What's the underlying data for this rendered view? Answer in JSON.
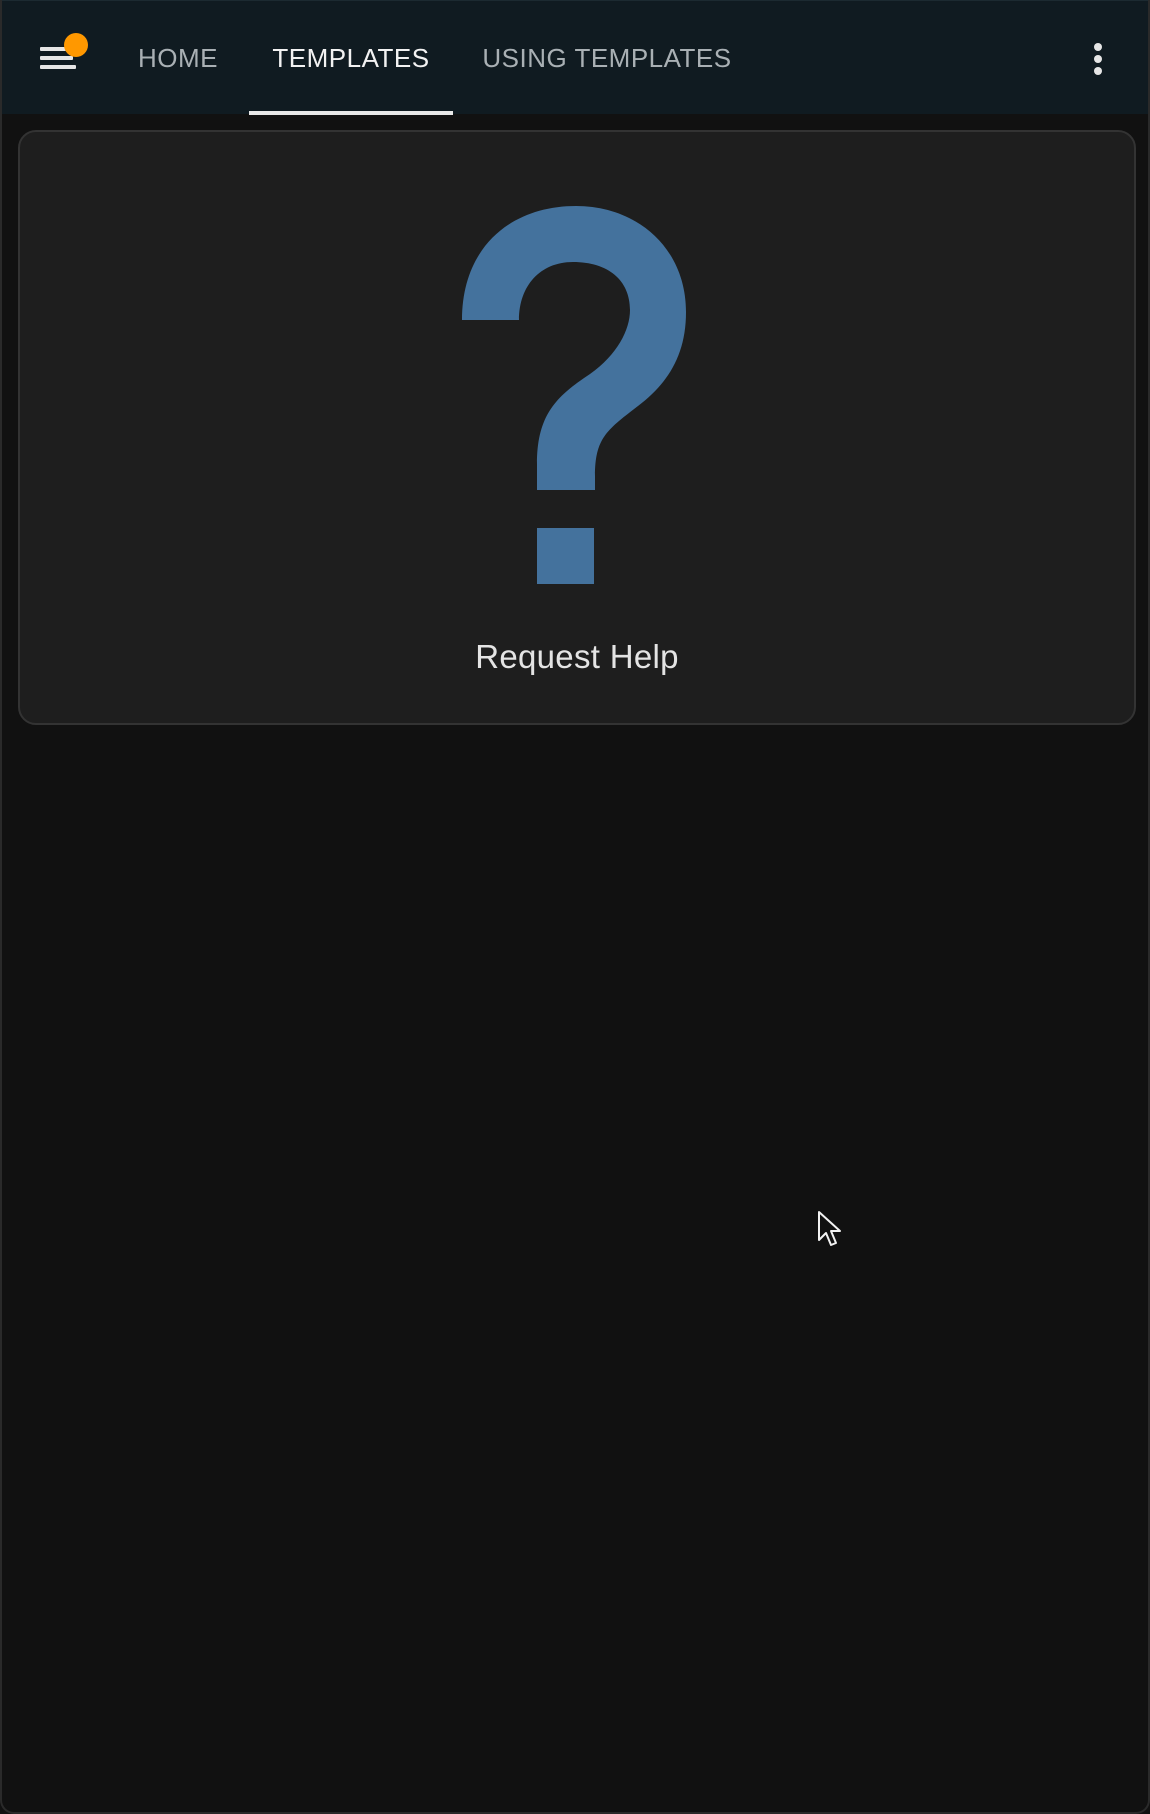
{
  "header": {
    "tabs": [
      {
        "label": "HOME",
        "active": false
      },
      {
        "label": "TEMPLATES",
        "active": true
      },
      {
        "label": "USING TEMPLATES",
        "active": false
      }
    ],
    "menu_icon": "menu-icon",
    "notification_dot_color": "#ff9800",
    "overflow_icon": "more-vertical-icon"
  },
  "main": {
    "cards": [
      {
        "icon": "question-mark-icon",
        "icon_color": "#44729d",
        "label": "Request Help"
      }
    ]
  },
  "colors": {
    "background": "#111111",
    "topbar": "#101b21",
    "card": "#1e1e1e",
    "accent": "#44729d",
    "badge": "#ff9800"
  }
}
